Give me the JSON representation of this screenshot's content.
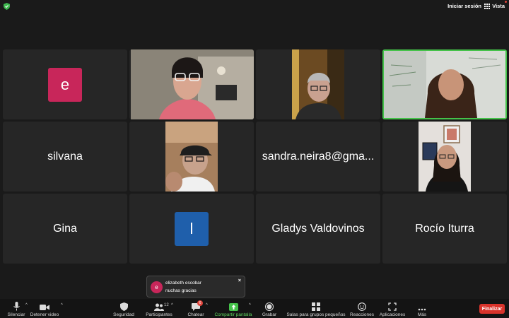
{
  "topbar": {
    "sign_in": "Iniciar sesión",
    "view": "Vista",
    "view_icon": "grid-icon",
    "shield_icon": "shield-check-icon"
  },
  "colors": {
    "active_speaker": "#45c24a",
    "end_button": "#d9332b",
    "share_green": "#5fd35f",
    "avatar_e": "#c8265a",
    "avatar_l": "#1f5fab"
  },
  "participants": [
    {
      "type": "avatar",
      "letter": "e"
    },
    {
      "type": "video",
      "desc": "woman-pink-shirt"
    },
    {
      "type": "video",
      "desc": "older-person-glasses"
    },
    {
      "type": "video",
      "desc": "woman-whiteboard",
      "active": true
    },
    {
      "type": "name",
      "name": "silvana"
    },
    {
      "type": "video",
      "desc": "man-cap"
    },
    {
      "type": "name",
      "name": "sandra.neira8@gma..."
    },
    {
      "type": "video",
      "desc": "woman-glasses-poster"
    },
    {
      "type": "name",
      "name": "Gina"
    },
    {
      "type": "avatar",
      "letter": "l"
    },
    {
      "type": "name",
      "name": "Gladys Valdovinos"
    },
    {
      "type": "name",
      "name": "Rocío Iturra"
    }
  ],
  "toast": {
    "avatar_letter": "e",
    "sender": "elizabeth escobar",
    "message": "nuchas gracias",
    "close": "×"
  },
  "toolbar": {
    "mute": "Silenciar",
    "stop_video": "Detener video",
    "security": "Seguridad",
    "participants": "Participantes",
    "participants_count": "12",
    "chat": "Chatear",
    "chat_badge": "6",
    "share": "Compartir pantalla",
    "record": "Grabar",
    "breakout": "Salas para grupos pequeños",
    "reactions": "Reacciones",
    "apps": "Aplicaciones",
    "more": "Más",
    "end": "Finalizar"
  }
}
